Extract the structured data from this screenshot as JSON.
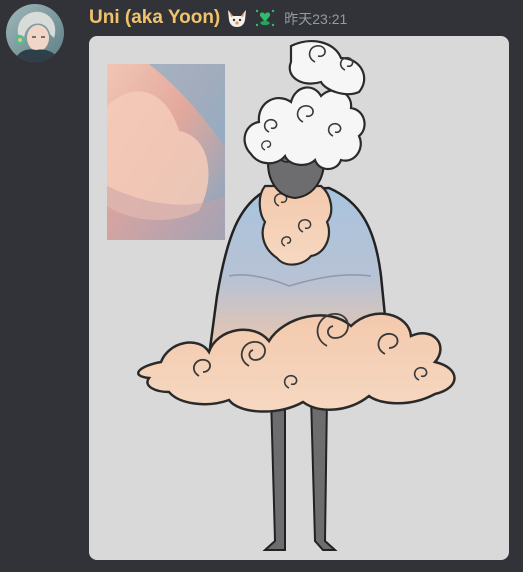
{
  "message": {
    "author": "Uni (aka Yoon)",
    "timestamp": "昨天23:21",
    "avatar_icon": "avatar-icon",
    "badges": [
      "fox-emoji-icon",
      "nitro-booster-icon"
    ],
    "attachment_icon": "image-attachment"
  },
  "colors": {
    "background": "#313338",
    "username": "#f0c36c",
    "timestamp": "#949ba4",
    "attachment_bg": "#d9d9d9"
  }
}
